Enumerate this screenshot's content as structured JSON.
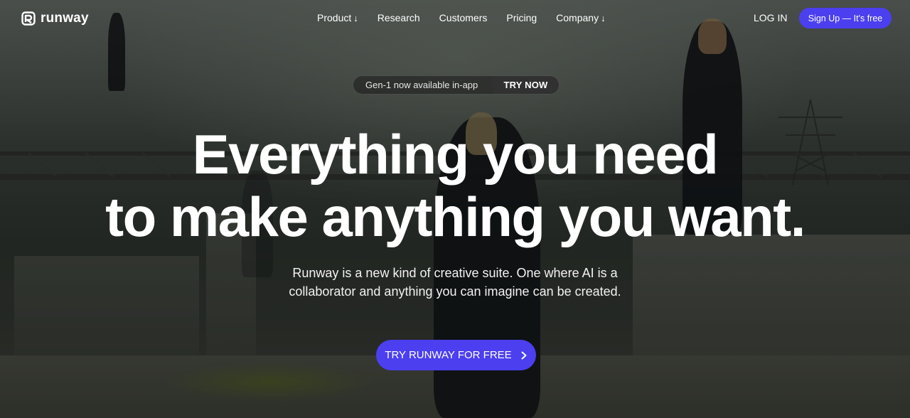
{
  "brand": {
    "name": "runway",
    "accent": "#4b3ff0"
  },
  "nav": {
    "items": [
      {
        "label": "Product",
        "arrow": "↓"
      },
      {
        "label": "Research"
      },
      {
        "label": "Customers"
      },
      {
        "label": "Pricing"
      },
      {
        "label": "Company",
        "arrow": "↓"
      }
    ],
    "login": "LOG IN",
    "signup": "Sign Up — It's free"
  },
  "announcement": {
    "text": "Gen-1 now available in-app",
    "cta": "TRY NOW"
  },
  "hero": {
    "headline_line1": "Everything you need",
    "headline_line2": "to make anything you want.",
    "subhead_line1": "Runway is a new kind of creative suite. One where AI is a",
    "subhead_line2": "collaborator and anything you can imagine can be created.",
    "cta": "TRY RUNWAY FOR FREE",
    "cta_icon": "chevron-right-icon"
  }
}
